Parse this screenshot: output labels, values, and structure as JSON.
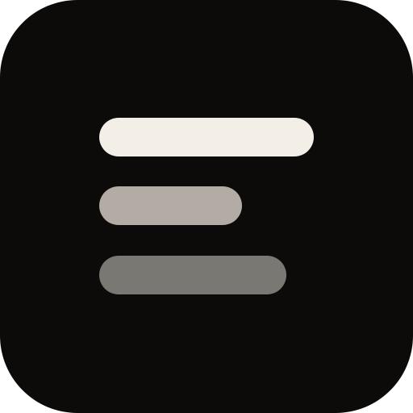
{
  "icon": {
    "name": "menu-lines-icon",
    "background_color": "#0c0b0a",
    "bars": [
      {
        "name": "top-bar",
        "color": "#f3efe6"
      },
      {
        "name": "middle-bar",
        "color": "#b2aca4"
      },
      {
        "name": "bottom-bar",
        "color": "#7a7872"
      }
    ]
  }
}
